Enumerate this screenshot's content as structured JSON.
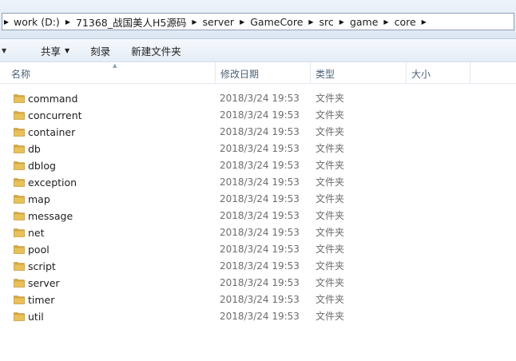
{
  "address": {
    "crumbs": [
      "work (D:)",
      "71368_战国美人H5源码",
      "server",
      "GameCore",
      "src",
      "game",
      "core"
    ]
  },
  "toolbar": {
    "share_label": "共享",
    "burn_label": "刻录",
    "new_folder_label": "新建文件夹"
  },
  "columns": {
    "name": "名称",
    "modified": "修改日期",
    "type": "类型",
    "size": "大小"
  },
  "files": [
    {
      "name": "command",
      "modified": "2018/3/24 19:53",
      "type": "文件夹"
    },
    {
      "name": "concurrent",
      "modified": "2018/3/24 19:53",
      "type": "文件夹"
    },
    {
      "name": "container",
      "modified": "2018/3/24 19:53",
      "type": "文件夹"
    },
    {
      "name": "db",
      "modified": "2018/3/24 19:53",
      "type": "文件夹"
    },
    {
      "name": "dblog",
      "modified": "2018/3/24 19:53",
      "type": "文件夹"
    },
    {
      "name": "exception",
      "modified": "2018/3/24 19:53",
      "type": "文件夹"
    },
    {
      "name": "map",
      "modified": "2018/3/24 19:53",
      "type": "文件夹"
    },
    {
      "name": "message",
      "modified": "2018/3/24 19:53",
      "type": "文件夹"
    },
    {
      "name": "net",
      "modified": "2018/3/24 19:53",
      "type": "文件夹"
    },
    {
      "name": "pool",
      "modified": "2018/3/24 19:53",
      "type": "文件夹"
    },
    {
      "name": "script",
      "modified": "2018/3/24 19:53",
      "type": "文件夹"
    },
    {
      "name": "server",
      "modified": "2018/3/24 19:53",
      "type": "文件夹"
    },
    {
      "name": "timer",
      "modified": "2018/3/24 19:53",
      "type": "文件夹"
    },
    {
      "name": "util",
      "modified": "2018/3/24 19:53",
      "type": "文件夹"
    }
  ],
  "icons": {
    "folder": "folder-icon",
    "crumb_separator": "chevron-right-icon",
    "dropdown": "caret-down-icon"
  },
  "colors": {
    "folder_body": "#e8c15b",
    "folder_tab": "#d9a93a",
    "header_text": "#4c607a",
    "meta_text": "#6d6d6d"
  }
}
